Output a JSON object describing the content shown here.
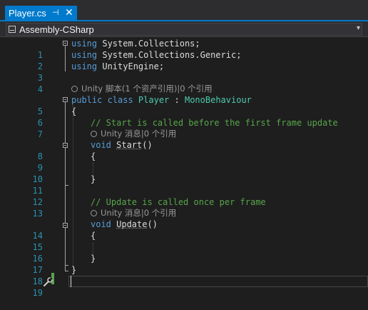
{
  "tab": {
    "title": "Player.cs",
    "pin_glyph": "⊣",
    "close_glyph": "✕",
    "pin_icon": "pin-icon",
    "close_icon": "close-icon"
  },
  "navbar": {
    "project": "Assembly-CSharp",
    "icon": "csharp-project-icon",
    "arrow": "▾"
  },
  "colors": {
    "keyword": "#569cd6",
    "type": "#4ec9b0",
    "comment": "#57a64a",
    "text": "#dcdcdc",
    "line_number": "#2b91af",
    "tab_accent": "#007acc",
    "lens": "#999999"
  },
  "lines": {
    "l1": {
      "num": "1",
      "kw": "using",
      "rest": " System.Collections;"
    },
    "l2": {
      "num": "2",
      "kw": "using",
      "rest": " System.Collections.Generic;"
    },
    "l3": {
      "num": "3",
      "kw": "using",
      "rest": " UnityEngine;"
    },
    "l4": {
      "num": "4"
    },
    "lens_class": "Unity 脚本(1 个资产引用)|0 个引用",
    "l5": {
      "num": "5",
      "kw": "public class ",
      "type": "Player",
      "sep": " : ",
      "base": "MonoBehaviour"
    },
    "l6": {
      "num": "6",
      "text": "{"
    },
    "l7": {
      "num": "7",
      "comment": "// Start is called before the first frame update"
    },
    "lens_start": "Unity 消息|0 个引用",
    "l8": {
      "num": "8",
      "kw": "void ",
      "fn": "Start",
      "paren": "()"
    },
    "l9": {
      "num": "9",
      "text": "{"
    },
    "l10": {
      "num": "10"
    },
    "l11": {
      "num": "11",
      "text": "}"
    },
    "l12": {
      "num": "12"
    },
    "l13": {
      "num": "13",
      "comment": "// Update is called once per frame"
    },
    "lens_update": "Unity 消息|0 个引用",
    "l14": {
      "num": "14",
      "kw": "void ",
      "fn": "Update",
      "paren": "()"
    },
    "l15": {
      "num": "15",
      "text": "{"
    },
    "l16": {
      "num": "16"
    },
    "l17": {
      "num": "17",
      "text": "}"
    },
    "l18": {
      "num": "18",
      "text": "}"
    },
    "l19": {
      "num": "19"
    }
  },
  "quick_action_icon": "wrench-icon"
}
